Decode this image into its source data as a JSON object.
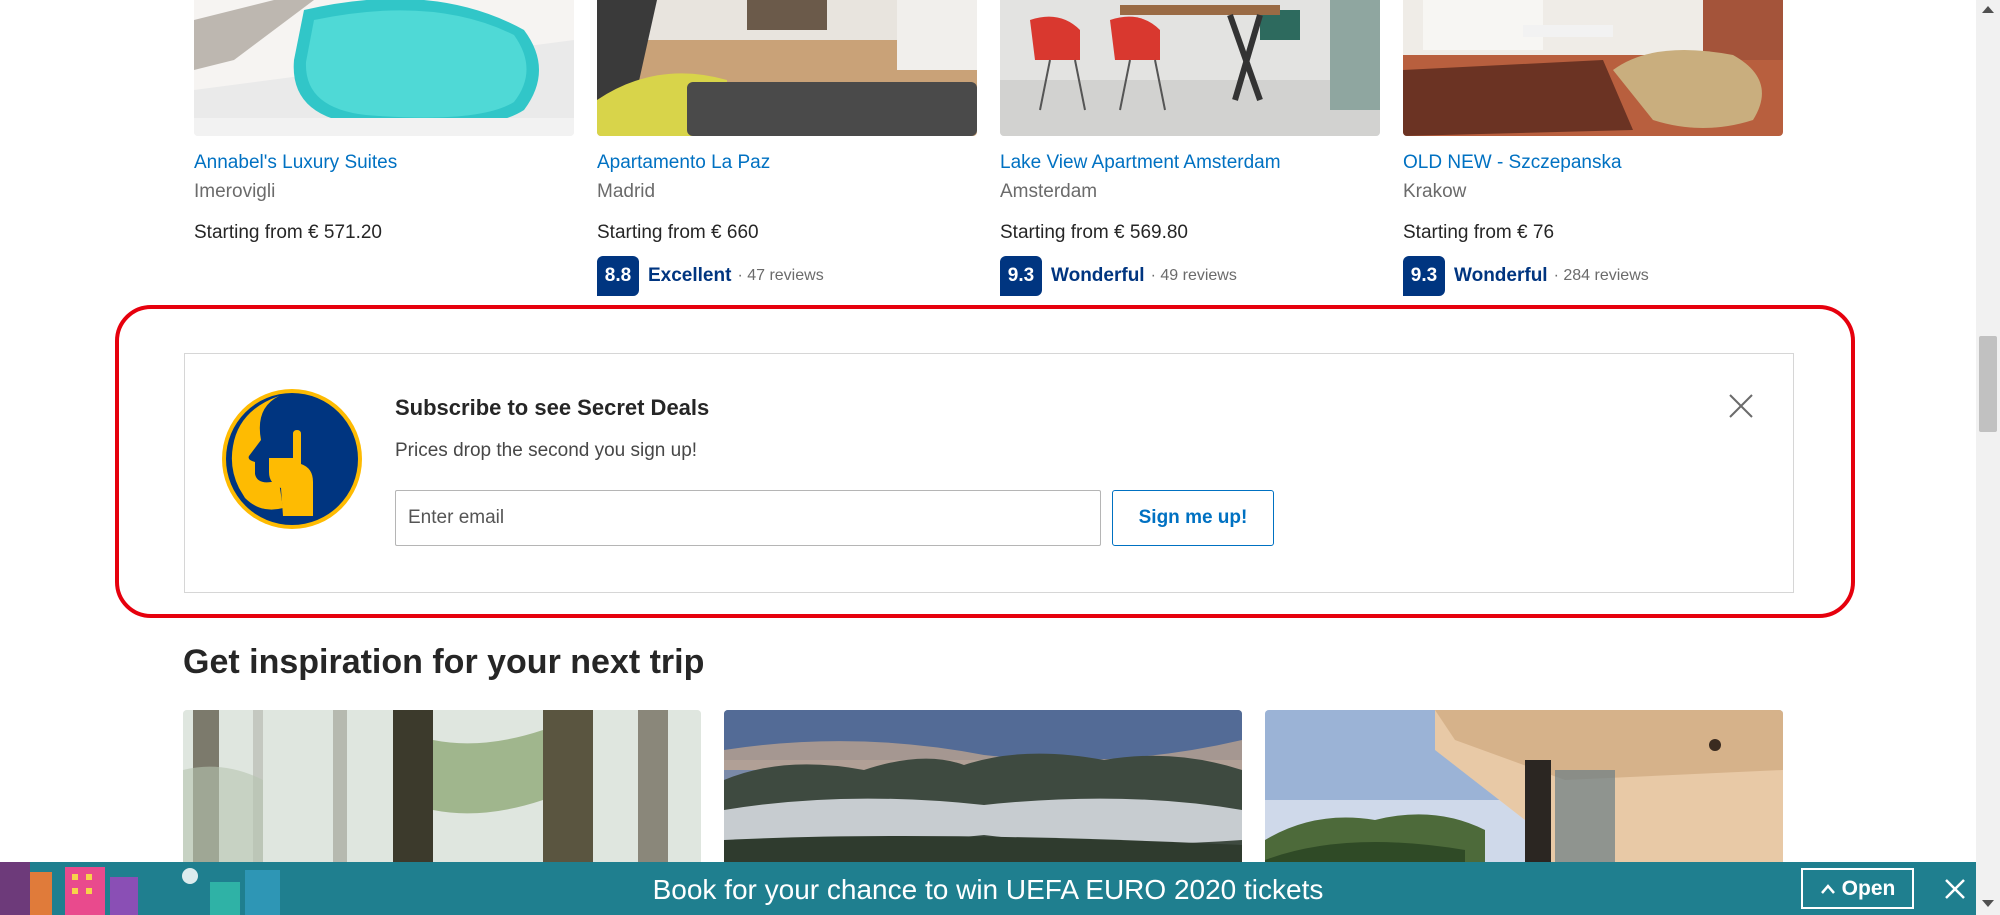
{
  "properties": [
    {
      "name": "Annabel's Luxury Suites",
      "city": "Imerovigli",
      "price": "Starting from € 571.20"
    },
    {
      "name": "Apartamento La Paz",
      "city": "Madrid",
      "price": "Starting from € 660",
      "score": "8.8",
      "word": "Excellent",
      "reviews": "· 47 reviews"
    },
    {
      "name": "Lake View Apartment Amsterdam",
      "city": "Amsterdam",
      "price": "Starting from € 569.80",
      "score": "9.3",
      "word": "Wonderful",
      "reviews": "· 49 reviews"
    },
    {
      "name": "OLD NEW - Szczepanska",
      "city": "Krakow",
      "price": "Starting from € 76",
      "score": "9.3",
      "word": "Wonderful",
      "reviews": "· 284 reviews"
    }
  ],
  "subscribe": {
    "title": "Subscribe to see Secret Deals",
    "text": "Prices drop the second you sign up!",
    "email_placeholder": "Enter email",
    "button": "Sign me up!",
    "close_icon": "close-icon",
    "logo_icon": "secret-deals-icon"
  },
  "inspiration": {
    "title": "Get inspiration for your next trip"
  },
  "banner": {
    "text": "Book for your chance to win UEFA EURO 2020 tickets",
    "open_label": "Open"
  },
  "colors": {
    "link": "#0071c2",
    "brand_dark": "#003580",
    "highlight": "#e6000d",
    "banner": "#1f7f8f",
    "logo_yellow": "#febb02"
  }
}
